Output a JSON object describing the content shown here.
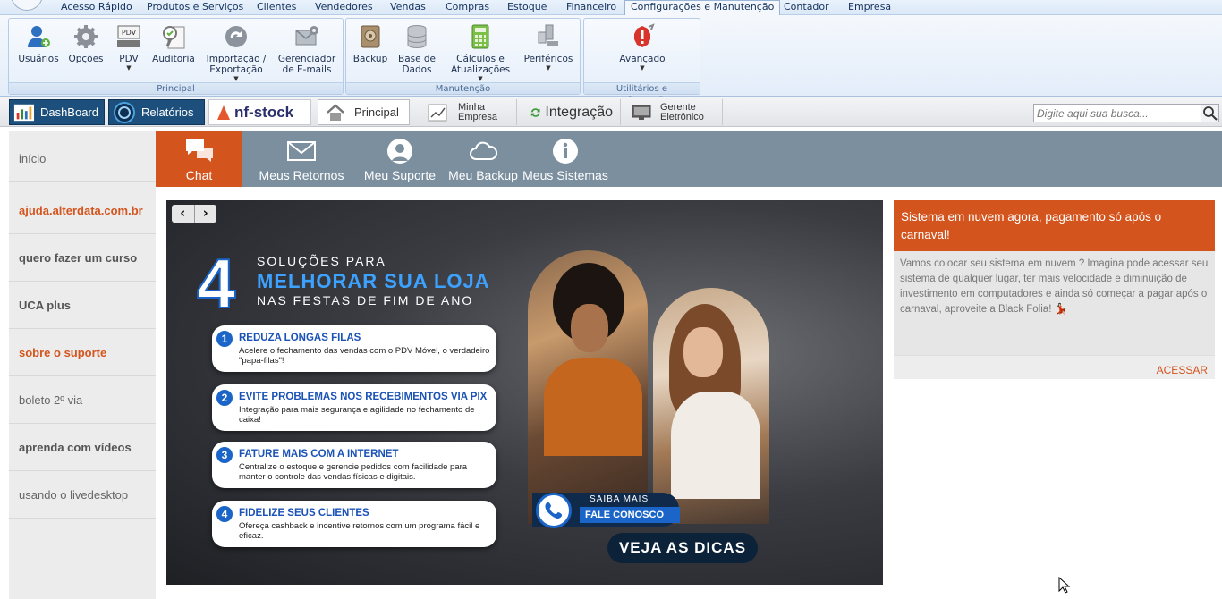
{
  "menu": {
    "items": [
      "Acesso Rápido",
      "Produtos e Serviços",
      "Clientes",
      "Vendedores",
      "Vendas",
      "Compras",
      "Estoque",
      "Financeiro",
      "Configurações e Manutenção",
      "Contador",
      "Empresa"
    ],
    "active": "Configurações e Manutenção"
  },
  "ribbon": {
    "groups": [
      {
        "label": "Principal",
        "buttons": [
          "Usuários",
          "Opções",
          "PDV",
          "Auditoria",
          "Importação / Exportação",
          "Gerenciador de E-mails"
        ]
      },
      {
        "label": "Manutenção",
        "buttons": [
          "Backup",
          "Base de Dados",
          "Cálculos e Atualizações",
          "Periféricos"
        ]
      },
      {
        "label": "Utilitários e Configurações",
        "buttons": [
          "Avançado"
        ]
      }
    ],
    "pdv_icon_text": "PDV"
  },
  "toolbar": {
    "dashboard": "DashBoard",
    "relatorios": "Relatórios",
    "nfstock": "nf-stock",
    "principal": "Principal",
    "minha_empresa_1": "Minha",
    "minha_empresa_2": "Empresa",
    "integracao": "Integração",
    "gerente_1": "Gerente",
    "gerente_2": "Eletrônico",
    "search_placeholder": "Digite aqui sua busca..."
  },
  "leftnav": {
    "items": [
      "início",
      "ajuda.alterdata.com.br",
      "quero fazer um curso",
      "UCA plus",
      "sobre o suporte",
      "boleto 2º via",
      "aprenda com vídeos",
      "usando o livedesktop"
    ]
  },
  "tabs": {
    "items": [
      "Chat",
      "Meus Retornos",
      "Meu Suporte",
      "Meu Backup",
      "Meus Sistemas"
    ],
    "active": "Chat"
  },
  "banner": {
    "big_number": "4",
    "line1": "SOLUÇÕES PARA",
    "line2": "MELHORAR SUA LOJA",
    "line3": "NAS FESTAS DE FIM DE ANO",
    "tips": [
      {
        "num": "1",
        "title": "REDUZA LONGAS FILAS",
        "body": "Acelere o fechamento das vendas com o PDV Móvel, o verdadeiro \"papa-filas\"!"
      },
      {
        "num": "2",
        "title": "EVITE PROBLEMAS NOS RECEBIMENTOS VIA PIX",
        "body": "Integração para mais segurança e agilidade no fechamento de caixa!"
      },
      {
        "num": "3",
        "title": "FATURE MAIS COM A INTERNET",
        "body": "Centralize o estoque e gerencie pedidos com facilidade para manter o controle das vendas físicas e digitais."
      },
      {
        "num": "4",
        "title": "FIDELIZE SEUS CLIENTES",
        "body": "Ofereça cashback e incentive retornos com um programa fácil e eficaz."
      }
    ],
    "cta_small": "SAIBA MAIS",
    "cta_big": "FALE CONOSCO",
    "veja": "VEJA AS DICAS"
  },
  "promo": {
    "title": "Sistema em nuvem agora, pagamento só após o carnaval!",
    "body": "Vamos colocar seu sistema em nuvem ? Imagina pode acessar seu sistema de qualquer lugar, ter mais velocidade e diminuição de investimento em computadores e ainda só começar a pagar após o carnaval, aproveite a Black Folia! 💃🏻",
    "link": "ACESSAR"
  },
  "colors": {
    "accent": "#d4541d",
    "tabbar": "#7b8f9f",
    "dark_button": "#1d4f7c"
  }
}
